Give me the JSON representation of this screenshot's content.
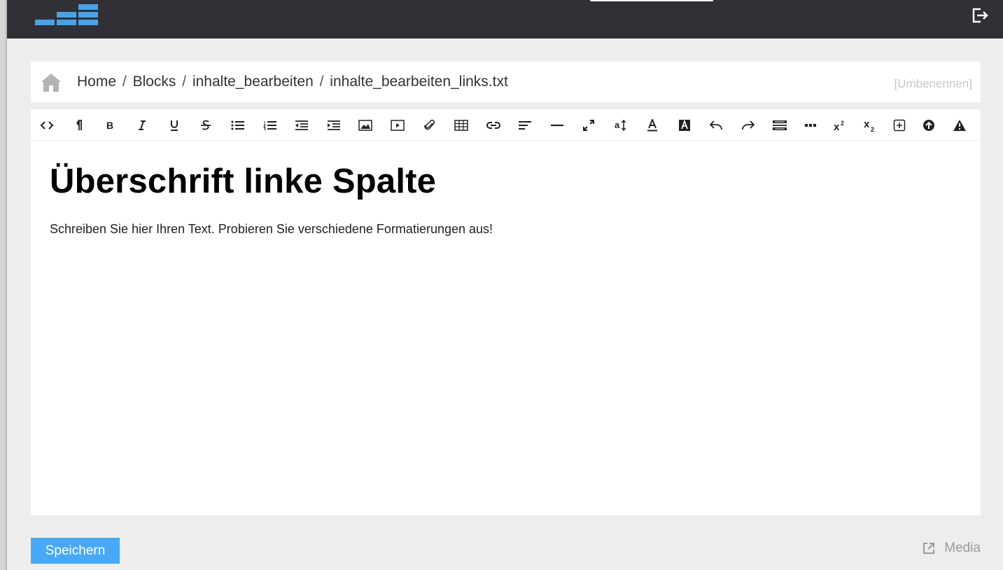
{
  "header": {
    "logo_icon": "bars-logo-icon",
    "logout_icon": "logout-icon"
  },
  "breadcrumb": {
    "home_icon": "home-icon",
    "items": [
      "Home",
      "Blocks",
      "inhalte_bearbeiten",
      "inhalte_bearbeiten_links.txt"
    ],
    "separator": "/",
    "rename_label": "[Umbenennen]"
  },
  "toolbar": {
    "buttons": [
      {
        "name": "html-source",
        "icon": "code-icon",
        "glyph": "<>"
      },
      {
        "name": "paragraph",
        "icon": "paragraph-icon",
        "glyph": "¶"
      },
      {
        "name": "bold",
        "icon": "bold-icon",
        "glyph": "B"
      },
      {
        "name": "italic",
        "icon": "italic-icon",
        "glyph": "I"
      },
      {
        "name": "underline",
        "icon": "underline-icon",
        "glyph": "U"
      },
      {
        "name": "strikethrough",
        "icon": "strikethrough-icon",
        "glyph": "S"
      },
      {
        "name": "unordered-list",
        "icon": "bullet-list-icon"
      },
      {
        "name": "ordered-list",
        "icon": "numbered-list-icon"
      },
      {
        "name": "outdent",
        "icon": "outdent-icon"
      },
      {
        "name": "indent",
        "icon": "indent-icon"
      },
      {
        "name": "image",
        "icon": "image-icon"
      },
      {
        "name": "video",
        "icon": "video-icon"
      },
      {
        "name": "file",
        "icon": "paperclip-icon"
      },
      {
        "name": "table",
        "icon": "table-icon"
      },
      {
        "name": "link",
        "icon": "link-icon"
      },
      {
        "name": "alignment",
        "icon": "align-left-icon"
      },
      {
        "name": "horizontal-rule",
        "icon": "horizontal-rule-icon"
      },
      {
        "name": "fullscreen",
        "icon": "expand-icon"
      },
      {
        "name": "font-size",
        "icon": "font-size-icon",
        "glyph": "a↕"
      },
      {
        "name": "font-color",
        "icon": "font-color-icon",
        "glyph": "A"
      },
      {
        "name": "background-color",
        "icon": "background-color-icon",
        "glyph": "A"
      },
      {
        "name": "undo",
        "icon": "undo-icon"
      },
      {
        "name": "redo",
        "icon": "redo-icon"
      },
      {
        "name": "format-block",
        "icon": "format-block-icon"
      },
      {
        "name": "more",
        "icon": "more-icon",
        "glyph": "•••"
      },
      {
        "name": "superscript",
        "icon": "superscript-icon",
        "glyph": "x²"
      },
      {
        "name": "subscript",
        "icon": "subscript-icon",
        "glyph": "x₂"
      },
      {
        "name": "insert",
        "icon": "plus-box-icon"
      },
      {
        "name": "upload",
        "icon": "upload-circle-icon"
      },
      {
        "name": "warning",
        "icon": "warning-icon"
      }
    ]
  },
  "content": {
    "heading": "Überschrift linke Spalte",
    "paragraph": "Schreiben Sie hier Ihren Text. Probieren Sie verschiedene Formatierungen aus!"
  },
  "footer": {
    "save_label": "Speichern",
    "media_label": "Media",
    "media_icon": "external-link-icon"
  },
  "colors": {
    "topbar": "#303036",
    "accent": "#47a9f5",
    "logo": "#4aa3e8",
    "background": "#ededed"
  }
}
